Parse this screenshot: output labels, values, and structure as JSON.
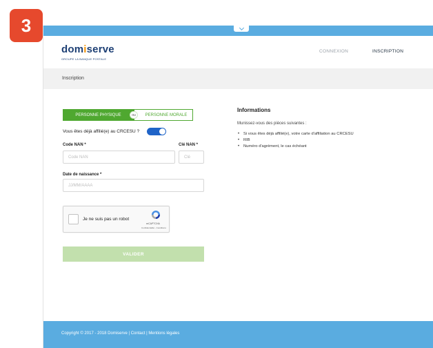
{
  "badge": "3",
  "header": {
    "logo_text_before": "dom",
    "logo_mark": "i",
    "logo_text_after": "serve",
    "logo_subtitle": "GROUPE LA BANQUE POSTALE",
    "nav": {
      "connexion": "CONNEXION",
      "inscription": "INSCRIPTION"
    }
  },
  "breadcrumb": "Inscription",
  "form": {
    "toggle": {
      "physique": "PERSONNE PHYSIQUE",
      "ou": "ou",
      "morale": "PERSONNE MORALE"
    },
    "affiliation_question": "Vous êtes déjà affilié(e) au CRCESU ?",
    "affiliation_switch_on": true,
    "code_nan_label": "Code NAN *",
    "code_nan_placeholder": "Code NAN",
    "cle_nan_label": "Clé NAN *",
    "cle_nan_placeholder": "Clé",
    "date_label": "Date de naissance *",
    "date_placeholder": "JJ/MM/AAAA",
    "captcha": {
      "label": "Je ne suis pas un robot",
      "brand": "reCAPTCHA",
      "links": "Confidentialité - Conditions"
    },
    "submit_label": "VALIDER"
  },
  "info": {
    "title": "Informations",
    "lead": "Munissez-vous des pièces suivantes :",
    "items": [
      "Si vous êtes déjà affilié(e), votre carte d'affiliation au CRCESU",
      "RIB",
      "Numéro d'agrément, le cas échéant"
    ]
  },
  "footer": {
    "copyright": "Copyright © 2017 - 2018 Domiserve",
    "sep": " | ",
    "contact": "Contact",
    "legal": "Mentions légales"
  },
  "colors": {
    "accent_blue": "#5aace0",
    "brand_green": "#4fa830",
    "badge_red": "#e6492d",
    "logo_blue": "#1d3f74",
    "logo_orange": "#f29100"
  }
}
